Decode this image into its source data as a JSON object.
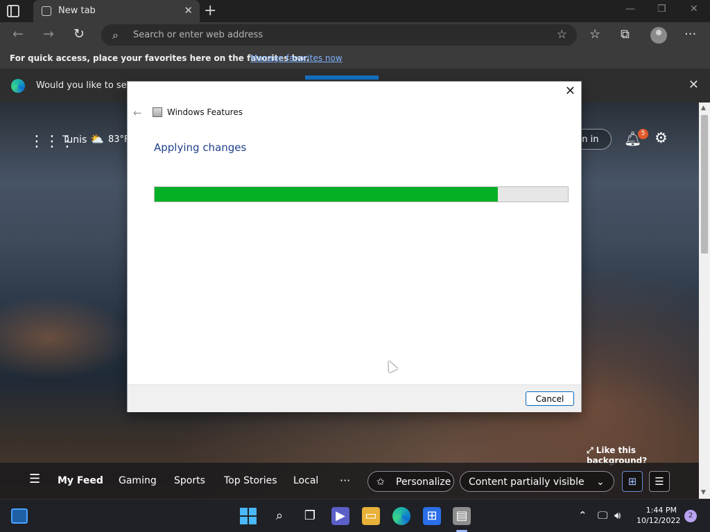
{
  "browser": {
    "tab_title": "New tab",
    "address_placeholder": "Search or enter web address",
    "favbar_text": "For quick access, place your favorites here on the favorites bar.",
    "favbar_link": "Manage favorites now",
    "infobar_text": "Would you like to set M"
  },
  "newtab": {
    "city": "Tunis",
    "temperature": "83°F",
    "signin_label": "gn in",
    "notification_count": "5",
    "like_background": "Like this background?",
    "feed_tabs": [
      "My Feed",
      "Gaming",
      "Sports",
      "Top Stories",
      "Local"
    ],
    "more": "···",
    "personalize": "Personalize",
    "content_visibility": "Content partially visible"
  },
  "dialog": {
    "title": "Windows Features",
    "heading": "Applying changes",
    "progress_fraction": 0.83,
    "cancel_label": "Cancel"
  },
  "taskbar": {
    "time": "1:44 PM",
    "date": "10/12/2022",
    "notification_count": "2"
  },
  "colors": {
    "progress_fill": "#06b025",
    "dialog_heading": "#1e3f8a",
    "accent": "#0067c0"
  }
}
